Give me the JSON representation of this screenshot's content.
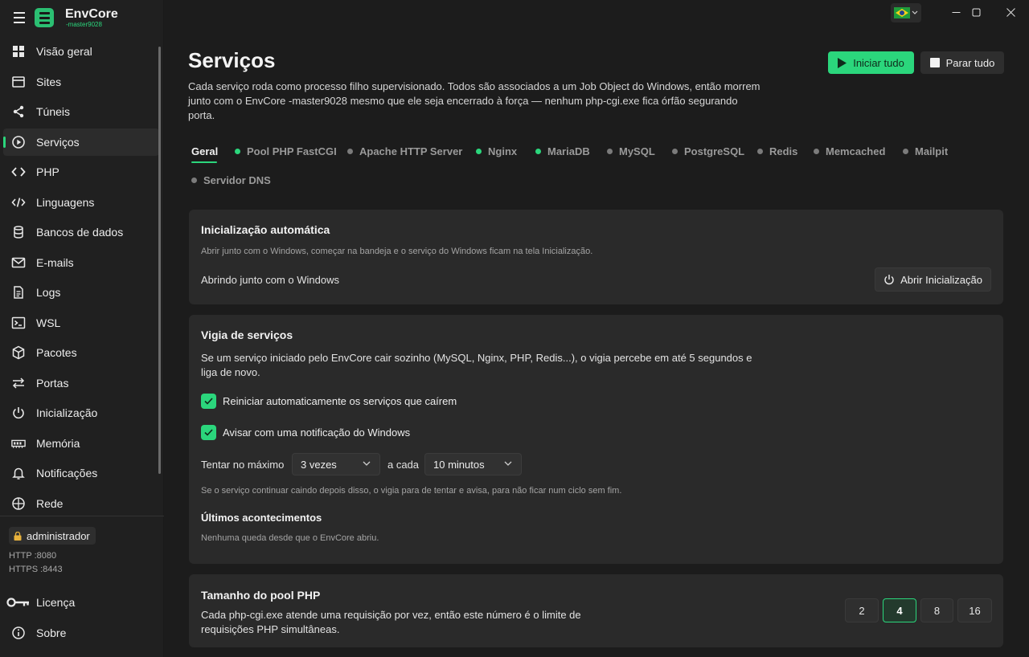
{
  "brand": {
    "name": "EnvCore",
    "sub": "-master9028"
  },
  "sidebar": {
    "items": [
      {
        "label": "Visão geral",
        "icon": "grid-icon"
      },
      {
        "label": "Sites",
        "icon": "browser-icon"
      },
      {
        "label": "Túneis",
        "icon": "share-icon"
      },
      {
        "label": "Serviços",
        "icon": "play-circle-icon",
        "active": true
      },
      {
        "label": "PHP",
        "icon": "code-icon"
      },
      {
        "label": "Linguagens",
        "icon": "code-slash-icon"
      },
      {
        "label": "Bancos de dados",
        "icon": "database-icon"
      },
      {
        "label": "E-mails",
        "icon": "mail-icon"
      },
      {
        "label": "Logs",
        "icon": "document-icon"
      },
      {
        "label": "WSL",
        "icon": "terminal-icon"
      },
      {
        "label": "Pacotes",
        "icon": "package-icon"
      },
      {
        "label": "Portas",
        "icon": "arrows-icon"
      },
      {
        "label": "Inicialização",
        "icon": "power-icon"
      },
      {
        "label": "Memória",
        "icon": "memory-icon"
      },
      {
        "label": "Notificações",
        "icon": "bell-icon"
      },
      {
        "label": "Rede",
        "icon": "globe-icon"
      }
    ],
    "user": "administrador",
    "http": "HTTP :8080",
    "https": "HTTPS :8443",
    "bottom": [
      {
        "label": "Licença",
        "icon": "key-icon"
      },
      {
        "label": "Sobre",
        "icon": "info-icon"
      }
    ]
  },
  "header": {
    "title": "Serviços",
    "description": "Cada serviço roda como processo filho supervisionado. Todos são associados a um Job Object do Windows, então morrem junto com o EnvCore -master9028 mesmo que ele seja encerrado à força — nenhum php-cgi.exe fica órfão segurando porta.",
    "start_all": "Iniciar tudo",
    "stop_all": "Parar tudo"
  },
  "tabs": [
    {
      "label": "Geral",
      "active": true
    },
    {
      "label": "Pool PHP FastCGI",
      "status": "on"
    },
    {
      "label": "Apache HTTP Server",
      "status": "off"
    },
    {
      "label": "Nginx",
      "status": "on"
    },
    {
      "label": "MariaDB",
      "status": "on"
    },
    {
      "label": "MySQL",
      "status": "off"
    },
    {
      "label": "PostgreSQL",
      "status": "off"
    },
    {
      "label": "Redis",
      "status": "off"
    },
    {
      "label": "Memcached",
      "status": "off"
    },
    {
      "label": "Mailpit",
      "status": "off"
    },
    {
      "label": "Servidor DNS",
      "status": "off"
    }
  ],
  "autostart": {
    "title": "Inicialização automática",
    "hint": "Abrir junto com o Windows, começar na bandeja e o serviço do Windows ficam na tela Inicialização.",
    "status": "Abrindo junto com o Windows",
    "button": "Abrir Inicialização"
  },
  "watchdog": {
    "title": "Vigia de serviços",
    "description": "Se um serviço iniciado pelo EnvCore cair sozinho (MySQL, Nginx, PHP, Redis...), o vigia percebe em até 5 segundos e liga de novo.",
    "check_restart": "Reiniciar automaticamente os serviços que caírem",
    "check_notify": "Avisar com uma notificação do Windows",
    "max_label": "Tentar no máximo",
    "max_value": "3 vezes",
    "every_label": "a cada",
    "every_value": "10 minutos",
    "hint": "Se o serviço continuar caindo depois disso, o vigia para de tentar e avisa, para não ficar num ciclo sem fim.",
    "events_title": "Últimos acontecimentos",
    "events_empty": "Nenhuma queda desde que o EnvCore abriu."
  },
  "pool": {
    "title": "Tamanho do pool PHP",
    "description": "Cada php-cgi.exe atende uma requisição por vez, então este número é o limite de requisições PHP simultâneas.",
    "options": [
      "2",
      "4",
      "8",
      "16"
    ],
    "selected": "4"
  },
  "colors": {
    "accent": "#2bd67c",
    "bg": "#1c1c1c",
    "card": "#2a2a2a"
  }
}
